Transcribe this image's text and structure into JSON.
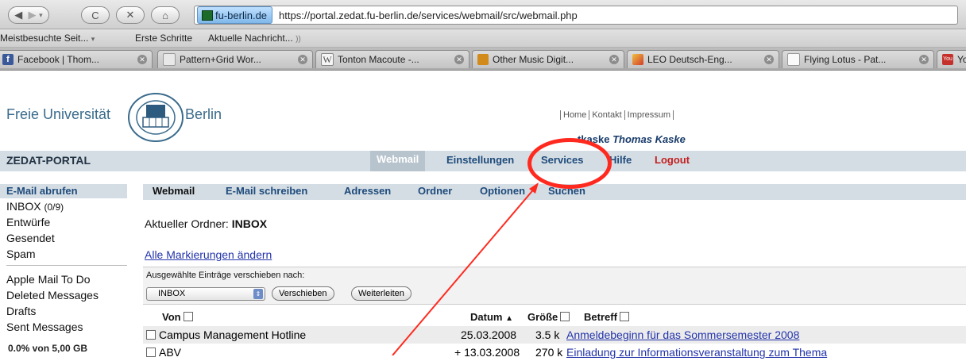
{
  "browser": {
    "site_badge": "fu-berlin.de",
    "url": "https://portal.zedat.fu-berlin.de/services/webmail/src/webmail.php"
  },
  "bookmarks": [
    "Meistbesuchte Seit...",
    "Erste Schritte",
    "Aktuelle Nachricht..."
  ],
  "tabs": [
    {
      "label": "Facebook | Thom...",
      "color": "#3b5998"
    },
    {
      "label": "Pattern+Grid Wor...",
      "color": "#999999"
    },
    {
      "label": "Tonton Macoute -...",
      "color": "#777777"
    },
    {
      "label": "Other Music Digit...",
      "color": "#d28a1b"
    },
    {
      "label": "LEO Deutsch-Eng...",
      "color": "#e0903b"
    },
    {
      "label": "Flying Lotus - Pat...",
      "color": "#dddddd"
    },
    {
      "label": "Yo",
      "color": "#c4302b"
    }
  ],
  "page": {
    "uni_left": "Freie Universität",
    "uni_right": "Berlin",
    "toplinks": [
      "Home",
      "Kontakt",
      "Impressum"
    ],
    "user_login": "tkaske",
    "user_name": "Thomas Kaske",
    "portal_title": "ZEDAT-PORTAL",
    "portal_tabs": [
      "Webmail",
      "Einstellungen",
      "Services",
      "Hilfe",
      "Logout"
    ],
    "left_heading": "E-Mail abrufen",
    "folders_top": [
      {
        "name": "INBOX",
        "count": "(0/9)"
      },
      {
        "name": "Entwürfe",
        "count": ""
      },
      {
        "name": "Gesendet",
        "count": ""
      },
      {
        "name": "Spam",
        "count": ""
      }
    ],
    "folders_bottom": [
      "Apple Mail To Do",
      "Deleted Messages",
      "Drafts",
      "Sent Messages"
    ],
    "quota": "0.0% von 5,00 GB",
    "sub_tabs": [
      "Webmail",
      "E-Mail schreiben",
      "Adressen",
      "Ordner",
      "Optionen",
      "Suchen"
    ],
    "current_folder_label": "Aktueller Ordner:",
    "current_folder": "INBOX",
    "mark_all": "Alle Markierungen ändern",
    "move_label": "Ausgewählte Einträge verschieben nach:",
    "move_select": "INBOX",
    "move_button": "Verschieben",
    "forward_button": "Weiterleiten",
    "columns": [
      "Von",
      "Datum",
      "Größe",
      "Betreff"
    ],
    "messages": [
      {
        "from": "Campus Management Hotline",
        "date": "25.03.2008",
        "size": "3.5 k",
        "subject": "Anmeldebeginn für das Sommersemester 2008"
      },
      {
        "from": "ABV",
        "date": "+ 13.03.2008",
        "size": "270 k",
        "subject": "Einladung zur Informationsveranstaltung zum Thema"
      }
    ]
  },
  "annotation": {
    "color": "#ff2a1f"
  }
}
